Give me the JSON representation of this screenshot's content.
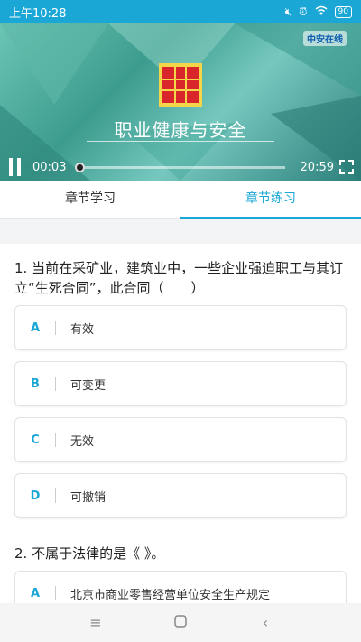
{
  "status_bar": {
    "time": "上午10:28",
    "battery": "90"
  },
  "video": {
    "logo": "中安在线",
    "title": "职业健康与安全",
    "current_time": "00:03",
    "total_time": "20:59",
    "progress_fraction": 0.002
  },
  "tabs": [
    {
      "label": "章节学习",
      "active": false
    },
    {
      "label": "章节练习",
      "active": true
    }
  ],
  "questions": [
    {
      "text": "1. 当前在采矿业，建筑业中，一些企业强迫职工与其订立“生死合同”，此合同（　　）",
      "options": [
        {
          "letter": "A",
          "text": "有效"
        },
        {
          "letter": "B",
          "text": "可变更"
        },
        {
          "letter": "C",
          "text": "无效"
        },
        {
          "letter": "D",
          "text": "可撤销"
        }
      ]
    },
    {
      "text": "2. 不属于法律的是《 》。",
      "options": [
        {
          "letter": "A",
          "text": "北京市商业零售经营单位安全生产规定"
        }
      ]
    }
  ],
  "colors": {
    "accent": "#1aa7d6"
  }
}
